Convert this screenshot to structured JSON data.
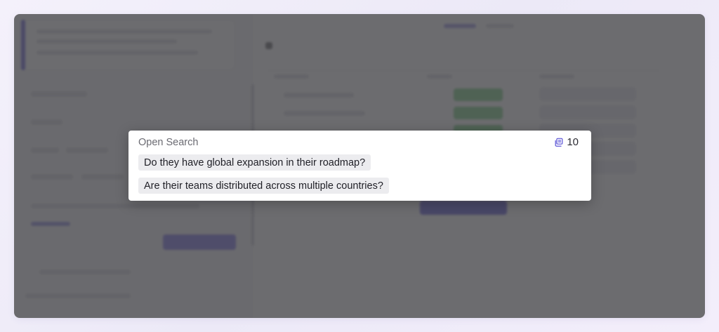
{
  "popup": {
    "title": "Open Search",
    "count": "10",
    "count_icon": "stack-icon",
    "questions": [
      "Do they have global expansion in their roadmap?",
      "Are their teams distributed across multiple countries?"
    ]
  },
  "colors": {
    "overlay": "#424246",
    "accent": "#5e56d8",
    "chip_bg": "#ececef",
    "title": "#6b6b72"
  }
}
